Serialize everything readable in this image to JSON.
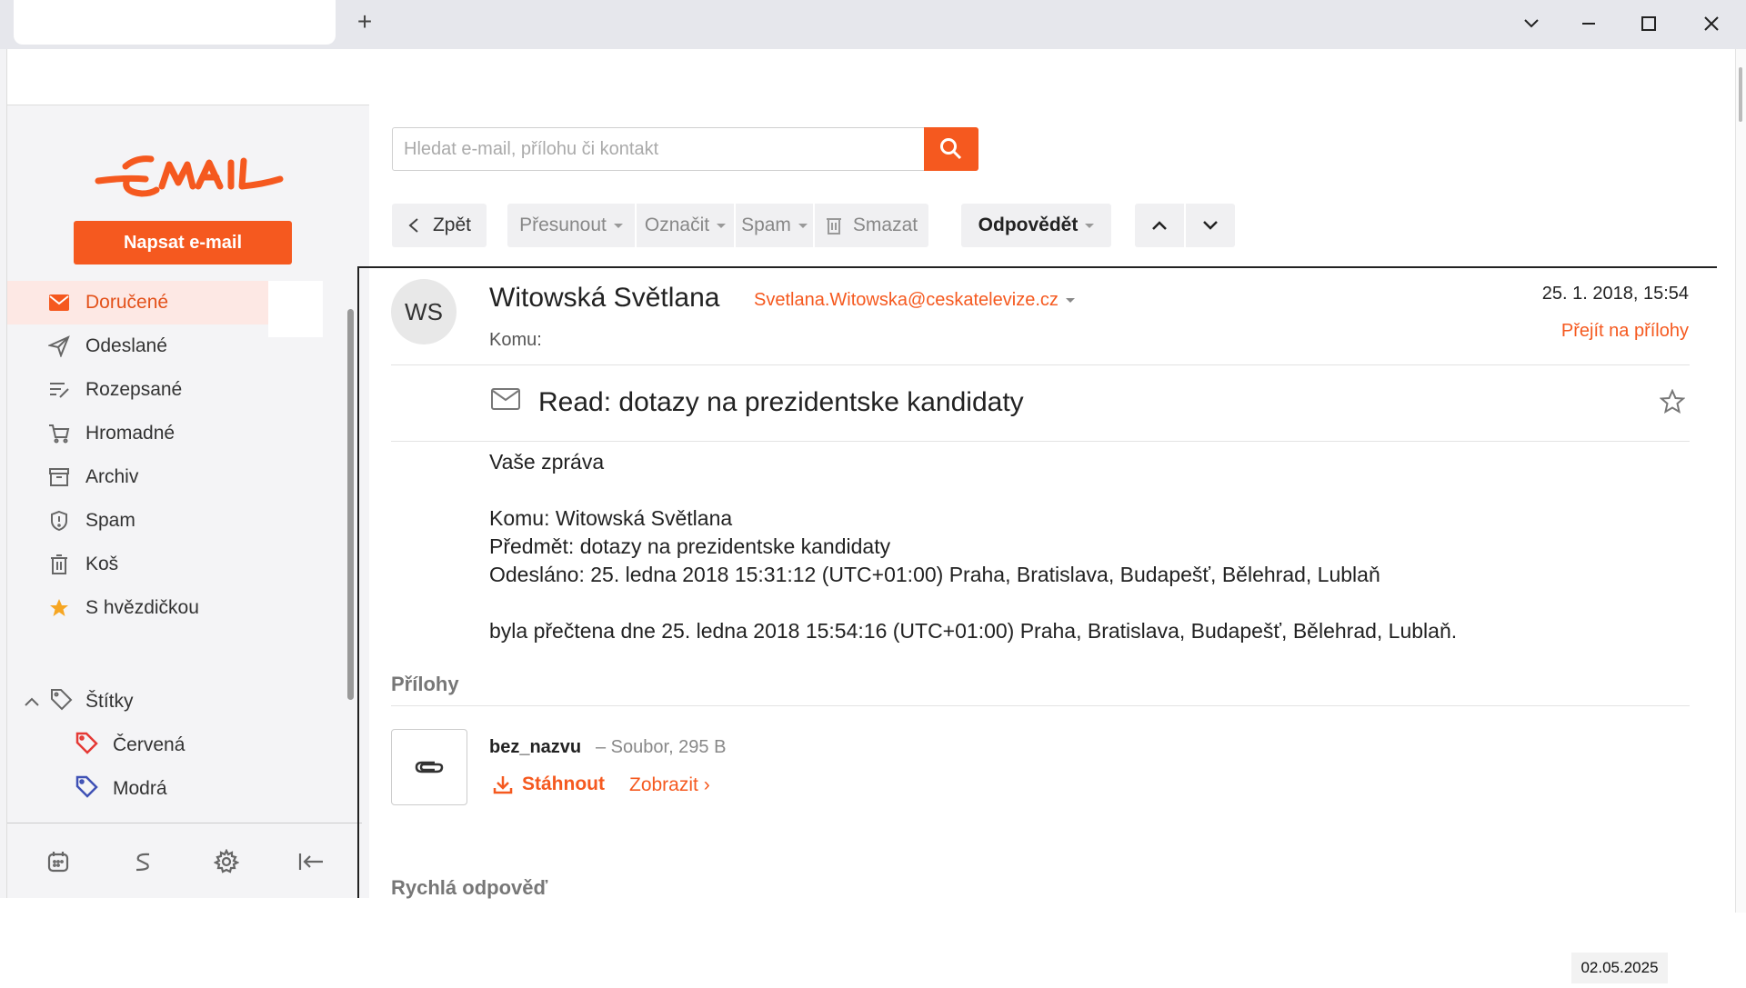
{
  "window": {
    "new_tab": "+"
  },
  "search": {
    "placeholder": "Hledat e-mail, přílohu či kontakt"
  },
  "sidebar": {
    "compose_label": "Napsat e-mail",
    "folders": [
      {
        "label": "Doručené",
        "icon": "mail-icon",
        "active": true
      },
      {
        "label": "Odeslané",
        "icon": "send-icon"
      },
      {
        "label": "Rozepsané",
        "icon": "draft-icon"
      },
      {
        "label": "Hromadné",
        "icon": "cart-icon"
      },
      {
        "label": "Archiv",
        "icon": "archive-icon"
      },
      {
        "label": "Spam",
        "icon": "shield-icon"
      },
      {
        "label": "Koš",
        "icon": "trash-icon"
      },
      {
        "label": "S hvězdičkou",
        "icon": "star-icon"
      }
    ],
    "labels_heading": "Štítky",
    "labels": [
      {
        "label": "Červená",
        "color": "#e53935"
      },
      {
        "label": "Modrá",
        "color": "#3f51b5"
      }
    ]
  },
  "toolbar": {
    "back_label": "Zpět",
    "move_label": "Přesunout",
    "mark_label": "Označit",
    "spam_label": "Spam",
    "delete_label": "Smazat",
    "reply_label": "Odpovědět"
  },
  "message": {
    "avatar_initials": "WS",
    "sender_name": "Witowská Světlana",
    "sender_email": "Svetlana.Witowska@ceskatelevize.cz",
    "to_label": "Komu:",
    "date": "25. 1. 2018, 15:54",
    "goto_attachments": "Přejít na přílohy",
    "subject": "Read: dotazy na prezidentske kandidaty",
    "body": [
      "Vaše zpráva",
      "Komu: Witowská Světlana",
      "Předmět: dotazy na prezidentske kandidaty",
      "Odesláno: 25. ledna 2018 15:31:12 (UTC+01:00) Praha, Bratislava, Budapešť, Bělehrad, Lublaň",
      "byla přečtena dne 25. ledna 2018 15:54:16 (UTC+01:00) Praha, Bratislava, Budapešť, Bělehrad, Lublaň."
    ]
  },
  "attachments": {
    "heading": "Přílohy",
    "items": [
      {
        "name": "bez_nazvu",
        "meta": "– Soubor, 295 B",
        "download": "Stáhnout",
        "view": "Zobrazit ›"
      }
    ]
  },
  "quick_reply": {
    "heading": "Rychlá odpověď"
  },
  "stamp": {
    "date": "02.05.2025"
  },
  "colors": {
    "accent": "#f5591f"
  }
}
